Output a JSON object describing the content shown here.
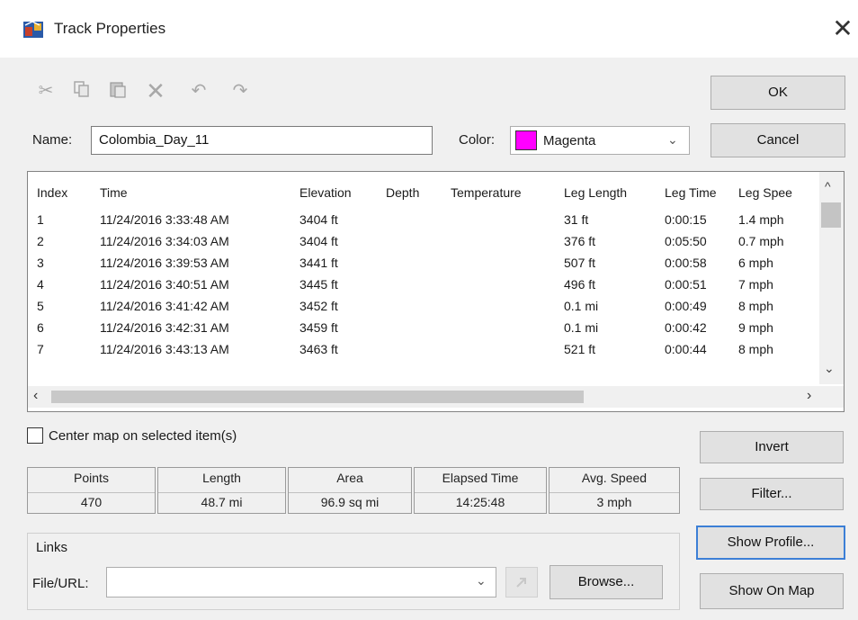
{
  "window": {
    "title": "Track Properties",
    "close_glyph": "✕"
  },
  "toolbar": {
    "icons": [
      "cut-icon",
      "copy-icon",
      "paste-icon",
      "delete-icon",
      "undo-icon",
      "redo-icon"
    ]
  },
  "buttons": {
    "ok": "OK",
    "cancel": "Cancel",
    "invert": "Invert",
    "filter": "Filter...",
    "show_profile": "Show Profile...",
    "show_on_map": "Show On Map",
    "browse": "Browse..."
  },
  "name_field": {
    "label": "Name:",
    "value": "Colombia_Day_11"
  },
  "color_field": {
    "label": "Color:",
    "value": "Magenta",
    "swatch": "#ff00ff"
  },
  "table": {
    "headers": [
      "Index",
      "Time",
      "Elevation",
      "Depth",
      "Temperature",
      "Leg Length",
      "Leg Time",
      "Leg Spee"
    ],
    "rows": [
      [
        "1",
        "11/24/2016 3:33:48 AM",
        "3404 ft",
        "",
        "",
        "31 ft",
        "0:00:15",
        "1.4 mph"
      ],
      [
        "2",
        "11/24/2016 3:34:03 AM",
        "3404 ft",
        "",
        "",
        "376 ft",
        "0:05:50",
        "0.7 mph"
      ],
      [
        "3",
        "11/24/2016 3:39:53 AM",
        "3441 ft",
        "",
        "",
        "507 ft",
        "0:00:58",
        "6 mph"
      ],
      [
        "4",
        "11/24/2016 3:40:51 AM",
        "3445 ft",
        "",
        "",
        "496 ft",
        "0:00:51",
        "7 mph"
      ],
      [
        "5",
        "11/24/2016 3:41:42 AM",
        "3452 ft",
        "",
        "",
        "0.1 mi",
        "0:00:49",
        "8 mph"
      ],
      [
        "6",
        "11/24/2016 3:42:31 AM",
        "3459 ft",
        "",
        "",
        "0.1 mi",
        "0:00:42",
        "9 mph"
      ],
      [
        "7",
        "11/24/2016 3:43:13 AM",
        "3463 ft",
        "",
        "",
        "521 ft",
        "0:00:44",
        "8 mph"
      ]
    ]
  },
  "center_map": {
    "label": "Center map on selected item(s)",
    "checked": false
  },
  "stats": [
    {
      "header": "Points",
      "value": "470"
    },
    {
      "header": "Length",
      "value": "48.7 mi"
    },
    {
      "header": "Area",
      "value": "96.9 sq mi"
    },
    {
      "header": "Elapsed Time",
      "value": "14:25:48"
    },
    {
      "header": "Avg. Speed",
      "value": "3 mph"
    }
  ],
  "links": {
    "group_label": "Links",
    "file_label": "File/URL:",
    "value": ""
  }
}
